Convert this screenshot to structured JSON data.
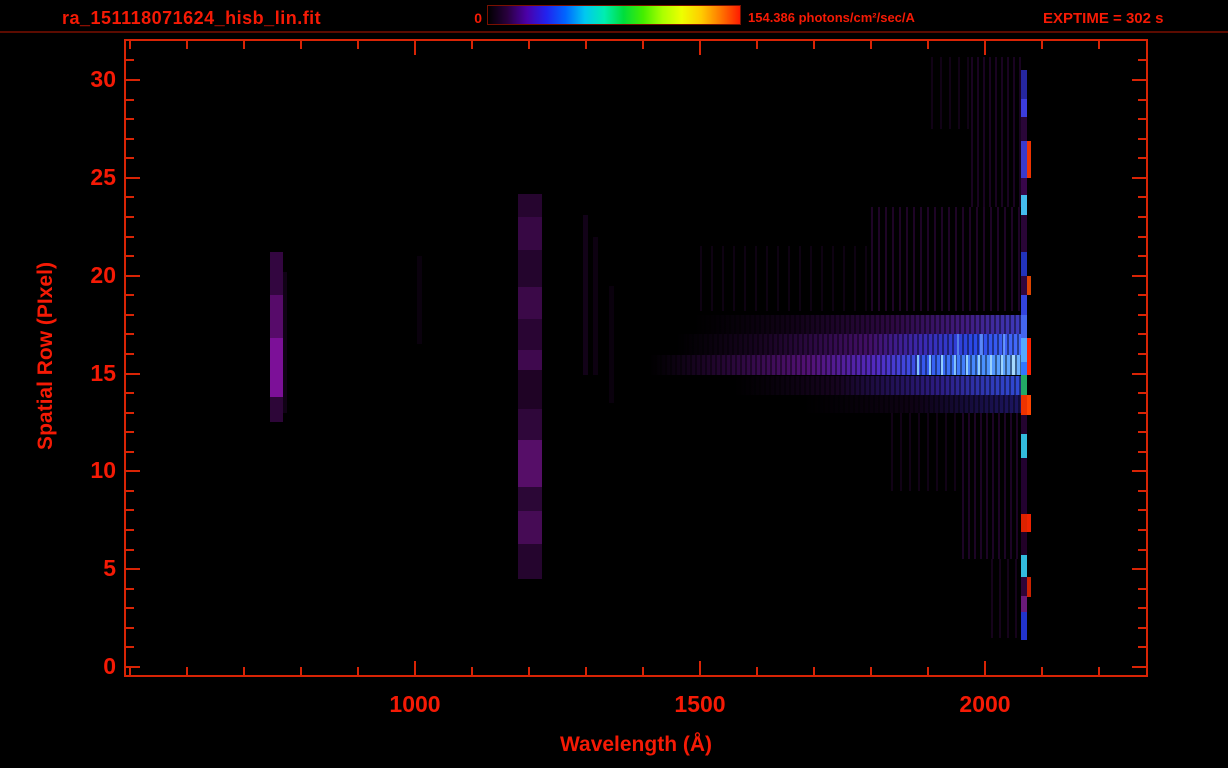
{
  "header": {
    "title": "ra_151118071624_hisb_lin.fit",
    "exptime": "EXPTIME = 302 s"
  },
  "chart_data": {
    "type": "heatmap",
    "description": "2D FUV spectrogram: intensity vs wavelength (x) and spatial row (y), rainbow colormap on black",
    "xlabel": "Wavelength (Å)",
    "ylabel": "Spatial Row (PIxel)",
    "x_axis": {
      "major_ticks": [
        1000,
        1500,
        2000
      ],
      "minor_step": 100,
      "minor_start": 500,
      "minor_end": 2200,
      "range_angstrom": [
        492,
        2272
      ]
    },
    "y_axis": {
      "major_ticks": [
        0,
        5,
        10,
        15,
        20,
        25,
        30
      ],
      "minor_step": 1,
      "minor_start": 0,
      "minor_end": 32,
      "range_rows": [
        -0.4,
        32.4
      ]
    },
    "colorbar": {
      "min_label": "0",
      "max_label": "154.386 photons/cm²/sec/A",
      "min_value": 0,
      "max_value": 154.386,
      "units": "photons/cm²/sec/A",
      "gradient_colors": [
        "#000000",
        "#29003e",
        "#4b00a8",
        "#2222ee",
        "#0066ff",
        "#00c8f0",
        "#00eeb0",
        "#00dd3c",
        "#44ee00",
        "#aaff00",
        "#eeff00",
        "#ffcc00",
        "#ff7700",
        "#ff1c00"
      ]
    },
    "exposure_time_s": 302,
    "features": [
      {
        "name": "emission-blob-760",
        "kind": "column",
        "lambda": [
          745,
          768
        ],
        "rows": [
          12.5,
          21.2
        ],
        "segments": [
          {
            "rows": [
              19.0,
              21.2
            ],
            "color": "rgba(64,8,80,0.8)"
          },
          {
            "rows": [
              16.8,
              19.0
            ],
            "color": "rgba(92,12,112,0.95)"
          },
          {
            "rows": [
              13.8,
              16.8
            ],
            "color": "rgba(124,16,152,1)"
          },
          {
            "rows": [
              12.5,
              13.8
            ],
            "color": "rgba(56,8,70,0.8)"
          }
        ]
      },
      {
        "name": "emission-blob-halo",
        "kind": "column",
        "lambda": [
          768,
          776
        ],
        "rows": [
          13.0,
          20.2
        ],
        "color": "rgba(36,5,46,0.45)"
      },
      {
        "name": "airglow-column-1200",
        "kind": "column",
        "lambda": [
          1181,
          1222
        ],
        "rows": [
          4.5,
          24.2
        ],
        "segments": [
          {
            "rows": [
              23.0,
              24.2
            ],
            "color": "rgba(42,6,52,0.9)"
          },
          {
            "rows": [
              21.3,
              23.0
            ],
            "color": "rgba(58,8,72,0.95)"
          },
          {
            "rows": [
              19.4,
              21.3
            ],
            "color": "rgba(40,5,50,0.9)"
          },
          {
            "rows": [
              17.8,
              19.4
            ],
            "color": "rgba(62,10,76,0.95)"
          },
          {
            "rows": [
              16.2,
              17.8
            ],
            "color": "rgba(46,6,56,0.9)"
          },
          {
            "rows": [
              15.2,
              16.2
            ],
            "color": "rgba(66,10,82,0.95)"
          },
          {
            "rows": [
              13.2,
              15.2
            ],
            "color": "rgba(36,4,44,0.85)"
          },
          {
            "rows": [
              11.6,
              13.2
            ],
            "color": "rgba(52,8,64,0.9)"
          },
          {
            "rows": [
              9.2,
              11.6
            ],
            "color": "rgba(86,14,104,1)"
          },
          {
            "rows": [
              8.0,
              9.2
            ],
            "color": "rgba(48,8,60,0.9)"
          },
          {
            "rows": [
              6.3,
              8.0
            ],
            "color": "rgba(74,12,90,0.95)"
          },
          {
            "rows": [
              4.5,
              6.3
            ],
            "color": "rgba(44,6,54,0.85)"
          }
        ]
      },
      {
        "name": "faint-column-1005",
        "kind": "column",
        "lambda": [
          1003,
          1012
        ],
        "rows": [
          16.5,
          21.0
        ],
        "color": "rgba(18,2,24,0.55)"
      },
      {
        "name": "faint-column-1300a",
        "kind": "column",
        "lambda": [
          1295,
          1303
        ],
        "rows": [
          14.9,
          23.1
        ],
        "color": "rgba(26,3,34,0.7)"
      },
      {
        "name": "faint-column-1300b",
        "kind": "column",
        "lambda": [
          1313,
          1321
        ],
        "rows": [
          14.9,
          22.0
        ],
        "color": "rgba(22,2,28,0.6)"
      },
      {
        "name": "faint-column-1345",
        "kind": "column",
        "lambda": [
          1340,
          1350
        ],
        "rows": [
          13.5,
          19.5
        ],
        "color": "rgba(20,2,26,0.5)"
      },
      {
        "name": "continuum-band-row18",
        "kind": "band",
        "lambda": [
          1490,
          2072
        ],
        "rows": [
          17.0,
          18.0
        ],
        "striated": true,
        "gradient": [
          {
            "stop": 0,
            "color": "rgba(0,0,0,0)"
          },
          {
            "stop": 30,
            "color": "rgba(34,4,46,0.5)"
          },
          {
            "stop": 60,
            "color": "rgba(56,10,82,0.8)"
          },
          {
            "stop": 82,
            "color": "rgba(72,30,142,0.9)"
          },
          {
            "stop": 100,
            "color": "rgba(64,64,204,0.95)"
          }
        ]
      },
      {
        "name": "continuum-band-row17",
        "kind": "band",
        "lambda": [
          1460,
          2072
        ],
        "rows": [
          15.95,
          17.0
        ],
        "striated": true,
        "gradient": [
          {
            "stop": 0,
            "color": "rgba(0,0,0,0)"
          },
          {
            "stop": 25,
            "color": "rgba(40,6,56,0.6)"
          },
          {
            "stop": 55,
            "color": "rgba(72,16,112,0.9)"
          },
          {
            "stop": 70,
            "color": "rgba(62,42,184,0.95)"
          },
          {
            "stop": 85,
            "color": "rgba(42,72,232,1)"
          },
          {
            "stop": 100,
            "color": "rgba(72,112,255,1)"
          }
        ]
      },
      {
        "name": "continuum-band-row16",
        "kind": "band",
        "lambda": [
          1412,
          2072
        ],
        "rows": [
          14.9,
          15.95
        ],
        "striated": true,
        "gradient": [
          {
            "stop": 0,
            "color": "rgba(0,0,0,0)"
          },
          {
            "stop": 18,
            "color": "rgba(48,8,66,0.7)"
          },
          {
            "stop": 42,
            "color": "rgba(86,18,122,0.95)"
          },
          {
            "stop": 60,
            "color": "rgba(82,42,192,1)"
          },
          {
            "stop": 74,
            "color": "rgba(52,92,242,1)"
          },
          {
            "stop": 88,
            "color": "rgba(72,142,255,1)"
          },
          {
            "stop": 100,
            "color": "rgba(112,182,255,1)"
          }
        ]
      },
      {
        "name": "continuum-band-row15",
        "kind": "band",
        "lambda": [
          1560,
          2072
        ],
        "rows": [
          13.9,
          14.9
        ],
        "striated": true,
        "gradient": [
          {
            "stop": 0,
            "color": "rgba(0,0,0,0)"
          },
          {
            "stop": 35,
            "color": "rgba(36,6,50,0.6)"
          },
          {
            "stop": 70,
            "color": "rgba(52,32,152,0.85)"
          },
          {
            "stop": 100,
            "color": "rgba(52,82,232,0.95)"
          }
        ]
      },
      {
        "name": "continuum-band-row14",
        "kind": "band",
        "lambda": [
          1680,
          2072
        ],
        "rows": [
          13.0,
          13.9
        ],
        "striated": true,
        "gradient": [
          {
            "stop": 0,
            "color": "rgba(0,0,0,0)"
          },
          {
            "stop": 50,
            "color": "rgba(28,4,40,0.5)"
          },
          {
            "stop": 100,
            "color": "rgba(42,32,144,0.7)"
          }
        ]
      },
      {
        "name": "scatter-fan-upper-inner",
        "kind": "stripes",
        "lambda": [
          1800,
          2070
        ],
        "rows": [
          18.2,
          23.5
        ],
        "stripes": {
          "color": "rgba(54,7,70,0.55)",
          "w": 2,
          "period": 7
        }
      },
      {
        "name": "scatter-fan-upper-outer",
        "kind": "stripes",
        "lambda": [
          1975,
          2070
        ],
        "rows": [
          23.5,
          31.2
        ],
        "stripes": {
          "color": "rgba(50,6,66,0.5)",
          "w": 2,
          "period": 6
        }
      },
      {
        "name": "scatter-fan-upper-left",
        "kind": "stripes",
        "lambda": [
          1500,
          1800
        ],
        "rows": [
          18.2,
          21.5
        ],
        "stripes": {
          "color": "rgba(40,5,52,0.35)",
          "w": 2,
          "period": 11
        }
      },
      {
        "name": "scatter-fan-upper-top",
        "kind": "stripes",
        "lambda": [
          1905,
          1975
        ],
        "rows": [
          27.5,
          31.2
        ],
        "stripes": {
          "color": "rgba(42,5,56,0.4)",
          "w": 2,
          "period": 9
        }
      },
      {
        "name": "scatter-fan-lower-inner",
        "kind": "stripes",
        "lambda": [
          1960,
          2070
        ],
        "rows": [
          5.5,
          13.0
        ],
        "stripes": {
          "color": "rgba(52,7,68,0.55)",
          "w": 2,
          "period": 6
        }
      },
      {
        "name": "scatter-fan-lower-left",
        "kind": "stripes",
        "lambda": [
          1835,
          1960
        ],
        "rows": [
          9.0,
          13.0
        ],
        "stripes": {
          "color": "rgba(42,5,56,0.4)",
          "w": 2,
          "period": 9
        }
      },
      {
        "name": "scatter-fan-lower-bottom",
        "kind": "stripes",
        "lambda": [
          2010,
          2070
        ],
        "rows": [
          1.5,
          5.5
        ],
        "stripes": {
          "color": "rgba(46,6,60,0.45)",
          "w": 2,
          "period": 8
        }
      },
      {
        "name": "bright-column-line",
        "kind": "vline",
        "lambda": [
          1880,
          1884
        ],
        "rows": [
          14.9,
          15.95
        ],
        "color": "rgba(140,205,255,0.9)"
      },
      {
        "name": "bright-column-line",
        "kind": "vline",
        "lambda": [
          1902,
          1906
        ],
        "rows": [
          14.9,
          15.95
        ],
        "color": "rgba(140,205,255,0.9)"
      },
      {
        "name": "bright-column-line",
        "kind": "vline",
        "lambda": [
          1923,
          1927
        ],
        "rows": [
          14.9,
          15.95
        ],
        "color": "rgba(150,210,255,0.95)"
      },
      {
        "name": "bright-column-line",
        "kind": "vline",
        "lambda": [
          1945,
          1949
        ],
        "rows": [
          14.9,
          15.95
        ],
        "color": "rgba(140,205,255,0.9)"
      },
      {
        "name": "bright-column-line",
        "kind": "vline",
        "lambda": [
          1966,
          1970
        ],
        "rows": [
          14.9,
          15.95
        ],
        "color": "rgba(150,210,255,0.95)"
      },
      {
        "name": "bright-column-line",
        "kind": "vline",
        "lambda": [
          1988,
          1992
        ],
        "rows": [
          14.9,
          15.95
        ],
        "color": "rgba(150,210,255,0.95)"
      },
      {
        "name": "bright-column-line",
        "kind": "vline",
        "lambda": [
          2008,
          2012
        ],
        "rows": [
          14.9,
          15.95
        ],
        "color": "rgba(160,215,255,0.95)"
      },
      {
        "name": "bright-column-line",
        "kind": "vline",
        "lambda": [
          2028,
          2032
        ],
        "rows": [
          14.9,
          15.95
        ],
        "color": "rgba(160,215,255,0.95)"
      },
      {
        "name": "bright-column-line",
        "kind": "vline",
        "lambda": [
          2048,
          2052
        ],
        "rows": [
          14.9,
          15.95
        ],
        "color": "rgba(170,220,255,0.95)"
      },
      {
        "name": "bright-column-line",
        "kind": "vline",
        "lambda": [
          1950,
          1954
        ],
        "rows": [
          15.95,
          17.0
        ],
        "color": "rgba(100,150,255,0.8)"
      },
      {
        "name": "bright-column-line",
        "kind": "vline",
        "lambda": [
          1992,
          1996
        ],
        "rows": [
          15.95,
          17.0
        ],
        "color": "rgba(100,150,255,0.8)"
      },
      {
        "name": "bright-column-line",
        "kind": "vline",
        "lambda": [
          2032,
          2036
        ],
        "rows": [
          15.95,
          17.0
        ],
        "color": "rgba(110,160,255,0.85)"
      },
      {
        "name": "edge-line-2070",
        "kind": "column",
        "lambda": [
          2063,
          2074
        ],
        "rows": [
          1.4,
          30.5
        ],
        "segments": [
          {
            "rows": [
              29.0,
              30.5
            ],
            "color": "rgba(42,42,176,0.9)"
          },
          {
            "rows": [
              28.1,
              29.0
            ],
            "color": "rgba(60,60,221,1)"
          },
          {
            "rows": [
              26.9,
              28.1
            ],
            "color": "rgba(42,6,56,1)"
          },
          {
            "rows": [
              25.0,
              26.9
            ],
            "color": "rgba(58,58,204,1)"
          },
          {
            "rows": [
              24.1,
              25.0
            ],
            "color": "rgba(56,6,74,1)"
          },
          {
            "rows": [
              23.1,
              24.1
            ],
            "color": "rgba(68,187,238,1)"
          },
          {
            "rows": [
              21.2,
              23.1
            ],
            "color": "rgba(42,5,54,1)"
          },
          {
            "rows": [
              20.0,
              21.2
            ],
            "color": "rgba(34,51,187,1)"
          },
          {
            "rows": [
              19.0,
              20.0
            ],
            "color": "rgba(48,6,62,1)"
          },
          {
            "rows": [
              18.0,
              19.0
            ],
            "color": "rgba(51,68,221,1)"
          },
          {
            "rows": [
              16.8,
              18.0
            ],
            "color": "rgba(68,102,238,1)"
          },
          {
            "rows": [
              15.6,
              16.8
            ],
            "color": "rgba(85,170,255,1)"
          },
          {
            "rows": [
              14.9,
              15.6
            ],
            "color": "rgba(51,119,255,1)"
          },
          {
            "rows": [
              13.9,
              14.9
            ],
            "color": "rgba(34,170,102,1)"
          },
          {
            "rows": [
              12.9,
              13.9
            ],
            "color": "rgba(238,51,0,1)"
          },
          {
            "rows": [
              11.9,
              12.9
            ],
            "color": "rgba(36,4,48,1)"
          },
          {
            "rows": [
              10.7,
              11.9
            ],
            "color": "rgba(51,187,221,1)"
          },
          {
            "rows": [
              7.8,
              10.7
            ],
            "color": "rgba(35,2,48,1)"
          },
          {
            "rows": [
              6.9,
              7.8
            ],
            "color": "rgba(221,34,0,1)"
          },
          {
            "rows": [
              5.7,
              6.9
            ],
            "color": "rgba(34,1,40,1)"
          },
          {
            "rows": [
              4.6,
              5.7
            ],
            "color": "rgba(51,187,221,1)"
          },
          {
            "rows": [
              3.6,
              4.6
            ],
            "color": "rgba(46,4,56,1)"
          },
          {
            "rows": [
              2.8,
              3.6
            ],
            "color": "rgba(106,26,122,1)"
          },
          {
            "rows": [
              1.4,
              2.8
            ],
            "color": "rgba(34,51,204,1)"
          }
        ]
      },
      {
        "name": "edge-red-accents",
        "kind": "column",
        "lambda": [
          2074,
          2081
        ],
        "rows": [
          1.4,
          30.5
        ],
        "segments": [
          {
            "rows": [
              25.0,
              26.9
            ],
            "color": "rgba(238,51,0,1)"
          },
          {
            "rows": [
              19.0,
              20.0
            ],
            "color": "rgba(221,68,0,1)"
          },
          {
            "rows": [
              14.9,
              16.8
            ],
            "color": "rgba(255,34,0,1)"
          },
          {
            "rows": [
              12.9,
              13.9
            ],
            "color": "rgba(255,68,0,1)"
          },
          {
            "rows": [
              6.9,
              7.8
            ],
            "color": "rgba(238,34,0,1)"
          },
          {
            "rows": [
              3.6,
              4.6
            ],
            "color": "rgba(204,34,0,1)"
          }
        ]
      }
    ]
  },
  "colors": {
    "label_red": "#f51a05",
    "axis_red": "#d92405",
    "background": "#000000"
  }
}
